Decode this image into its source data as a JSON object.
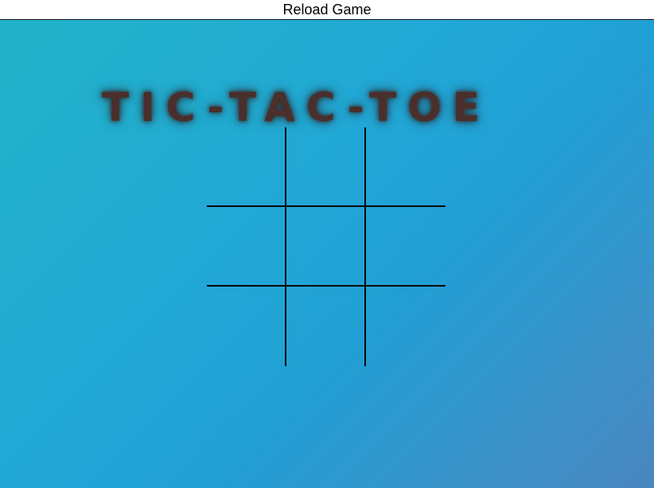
{
  "header": {
    "reload_label": "Reload Game"
  },
  "game": {
    "title": "TIC-TAC-TOE",
    "board": [
      [
        "",
        "",
        ""
      ],
      [
        "",
        "",
        ""
      ],
      [
        "",
        "",
        ""
      ]
    ]
  },
  "colors": {
    "background_start": "#22b3c9",
    "background_mid": "#21a6d6",
    "background_end": "#4a86c0",
    "title": "#4a2f2c",
    "grid_line": "#0a0a0a"
  }
}
